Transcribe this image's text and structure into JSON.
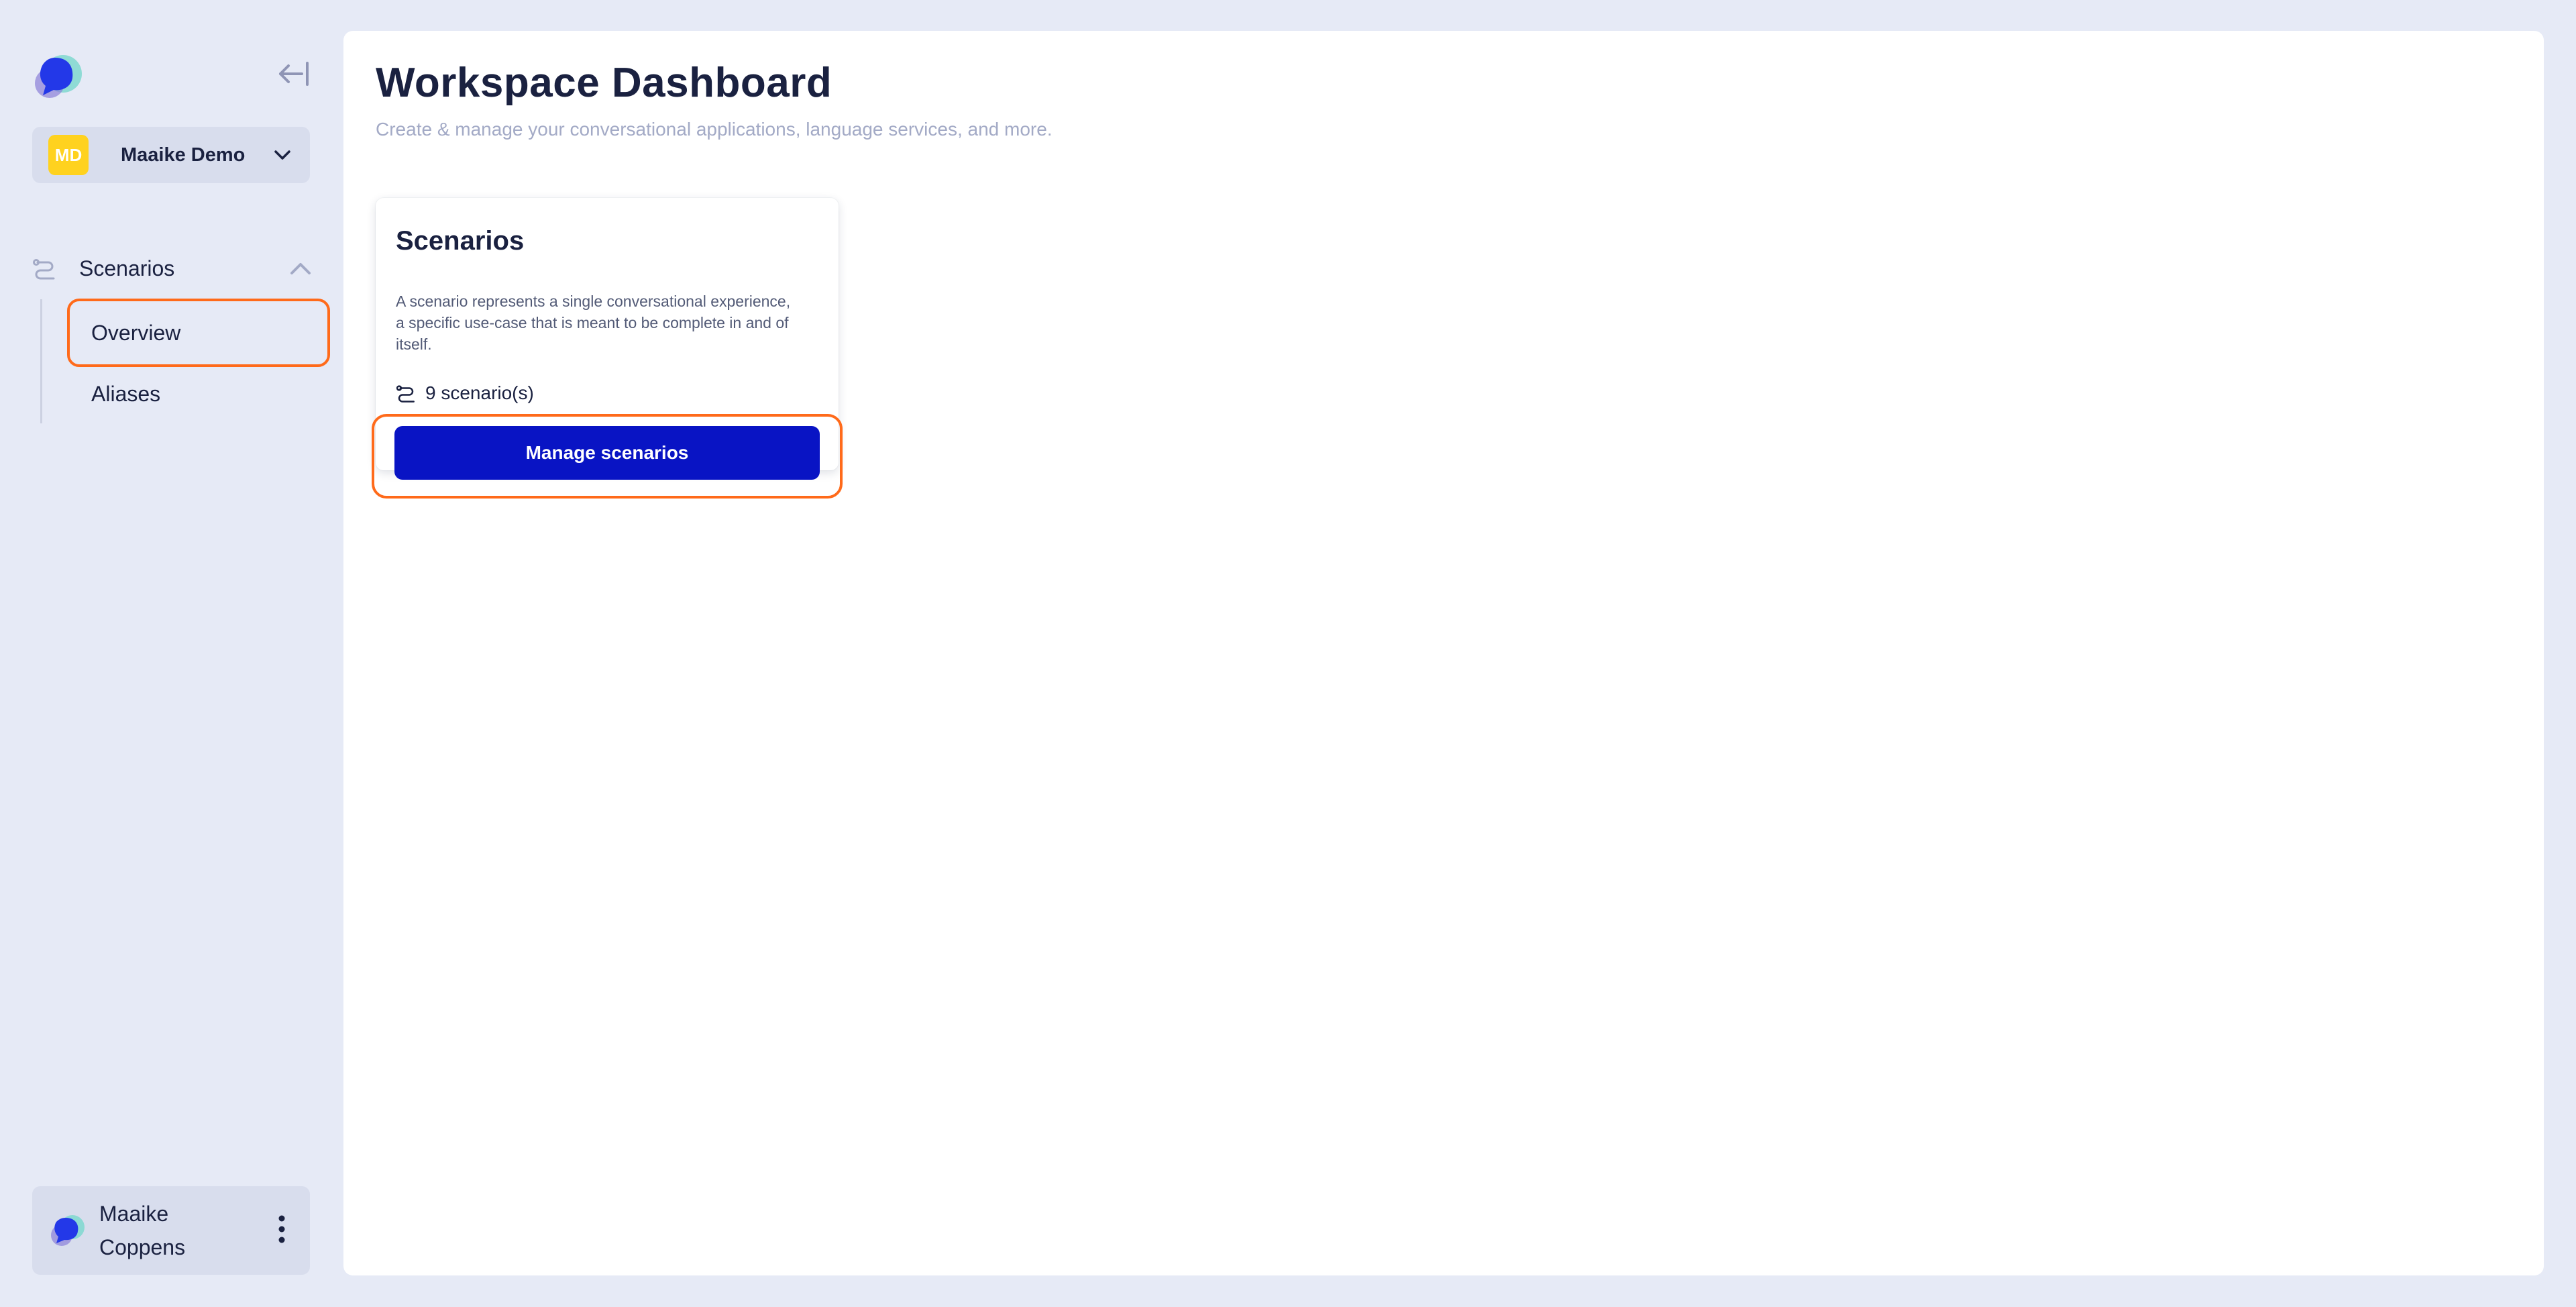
{
  "sidebar": {
    "workspace": {
      "initials": "MD",
      "name": "Maaike Demo",
      "avatar_color": "#ffd21f"
    },
    "nav": {
      "group_label": "Scenarios",
      "items": [
        {
          "label": "Overview",
          "active": true
        },
        {
          "label": "Aliases",
          "active": false
        }
      ]
    },
    "user": {
      "name_line1": "Maaike",
      "name_line2": "Coppens"
    }
  },
  "main": {
    "title": "Workspace Dashboard",
    "subtitle": "Create & manage your conversational applications, language services, and more.",
    "card": {
      "title": "Scenarios",
      "description": "A scenario represents a single conversational experience, a specific use-case that is meant to be complete in and of itself.",
      "count_label": "9 scenario(s)",
      "button_label": "Manage scenarios"
    }
  },
  "colors": {
    "background": "#e6eaf6",
    "accent_button": "#0914c4",
    "highlight_outline": "#ff6a1a",
    "logo_blue": "#2338e8",
    "logo_teal": "#7fd8cf"
  },
  "icons": {
    "logo": "chat-bubble-logo",
    "collapse": "arrow-left-bar-icon",
    "workspace_chevron": "chevron-down-icon",
    "scenarios": "route-icon",
    "group_chevron": "chevron-up-icon",
    "user_menu": "more-vertical-icon"
  }
}
